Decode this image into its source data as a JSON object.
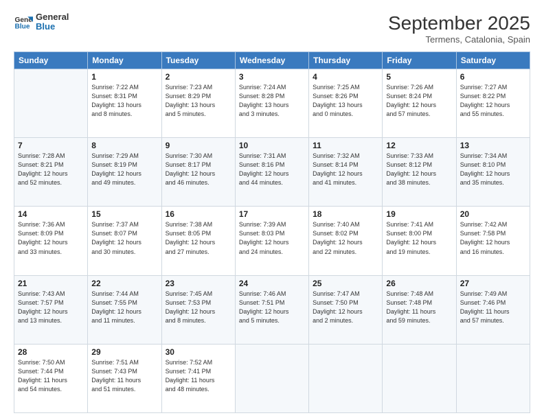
{
  "header": {
    "logo_line1": "General",
    "logo_line2": "Blue",
    "month": "September 2025",
    "location": "Termens, Catalonia, Spain"
  },
  "weekdays": [
    "Sunday",
    "Monday",
    "Tuesday",
    "Wednesday",
    "Thursday",
    "Friday",
    "Saturday"
  ],
  "weeks": [
    [
      {
        "day": "",
        "info": ""
      },
      {
        "day": "1",
        "info": "Sunrise: 7:22 AM\nSunset: 8:31 PM\nDaylight: 13 hours\nand 8 minutes."
      },
      {
        "day": "2",
        "info": "Sunrise: 7:23 AM\nSunset: 8:29 PM\nDaylight: 13 hours\nand 5 minutes."
      },
      {
        "day": "3",
        "info": "Sunrise: 7:24 AM\nSunset: 8:28 PM\nDaylight: 13 hours\nand 3 minutes."
      },
      {
        "day": "4",
        "info": "Sunrise: 7:25 AM\nSunset: 8:26 PM\nDaylight: 13 hours\nand 0 minutes."
      },
      {
        "day": "5",
        "info": "Sunrise: 7:26 AM\nSunset: 8:24 PM\nDaylight: 12 hours\nand 57 minutes."
      },
      {
        "day": "6",
        "info": "Sunrise: 7:27 AM\nSunset: 8:22 PM\nDaylight: 12 hours\nand 55 minutes."
      }
    ],
    [
      {
        "day": "7",
        "info": "Sunrise: 7:28 AM\nSunset: 8:21 PM\nDaylight: 12 hours\nand 52 minutes."
      },
      {
        "day": "8",
        "info": "Sunrise: 7:29 AM\nSunset: 8:19 PM\nDaylight: 12 hours\nand 49 minutes."
      },
      {
        "day": "9",
        "info": "Sunrise: 7:30 AM\nSunset: 8:17 PM\nDaylight: 12 hours\nand 46 minutes."
      },
      {
        "day": "10",
        "info": "Sunrise: 7:31 AM\nSunset: 8:16 PM\nDaylight: 12 hours\nand 44 minutes."
      },
      {
        "day": "11",
        "info": "Sunrise: 7:32 AM\nSunset: 8:14 PM\nDaylight: 12 hours\nand 41 minutes."
      },
      {
        "day": "12",
        "info": "Sunrise: 7:33 AM\nSunset: 8:12 PM\nDaylight: 12 hours\nand 38 minutes."
      },
      {
        "day": "13",
        "info": "Sunrise: 7:34 AM\nSunset: 8:10 PM\nDaylight: 12 hours\nand 35 minutes."
      }
    ],
    [
      {
        "day": "14",
        "info": "Sunrise: 7:36 AM\nSunset: 8:09 PM\nDaylight: 12 hours\nand 33 minutes."
      },
      {
        "day": "15",
        "info": "Sunrise: 7:37 AM\nSunset: 8:07 PM\nDaylight: 12 hours\nand 30 minutes."
      },
      {
        "day": "16",
        "info": "Sunrise: 7:38 AM\nSunset: 8:05 PM\nDaylight: 12 hours\nand 27 minutes."
      },
      {
        "day": "17",
        "info": "Sunrise: 7:39 AM\nSunset: 8:03 PM\nDaylight: 12 hours\nand 24 minutes."
      },
      {
        "day": "18",
        "info": "Sunrise: 7:40 AM\nSunset: 8:02 PM\nDaylight: 12 hours\nand 22 minutes."
      },
      {
        "day": "19",
        "info": "Sunrise: 7:41 AM\nSunset: 8:00 PM\nDaylight: 12 hours\nand 19 minutes."
      },
      {
        "day": "20",
        "info": "Sunrise: 7:42 AM\nSunset: 7:58 PM\nDaylight: 12 hours\nand 16 minutes."
      }
    ],
    [
      {
        "day": "21",
        "info": "Sunrise: 7:43 AM\nSunset: 7:57 PM\nDaylight: 12 hours\nand 13 minutes."
      },
      {
        "day": "22",
        "info": "Sunrise: 7:44 AM\nSunset: 7:55 PM\nDaylight: 12 hours\nand 11 minutes."
      },
      {
        "day": "23",
        "info": "Sunrise: 7:45 AM\nSunset: 7:53 PM\nDaylight: 12 hours\nand 8 minutes."
      },
      {
        "day": "24",
        "info": "Sunrise: 7:46 AM\nSunset: 7:51 PM\nDaylight: 12 hours\nand 5 minutes."
      },
      {
        "day": "25",
        "info": "Sunrise: 7:47 AM\nSunset: 7:50 PM\nDaylight: 12 hours\nand 2 minutes."
      },
      {
        "day": "26",
        "info": "Sunrise: 7:48 AM\nSunset: 7:48 PM\nDaylight: 11 hours\nand 59 minutes."
      },
      {
        "day": "27",
        "info": "Sunrise: 7:49 AM\nSunset: 7:46 PM\nDaylight: 11 hours\nand 57 minutes."
      }
    ],
    [
      {
        "day": "28",
        "info": "Sunrise: 7:50 AM\nSunset: 7:44 PM\nDaylight: 11 hours\nand 54 minutes."
      },
      {
        "day": "29",
        "info": "Sunrise: 7:51 AM\nSunset: 7:43 PM\nDaylight: 11 hours\nand 51 minutes."
      },
      {
        "day": "30",
        "info": "Sunrise: 7:52 AM\nSunset: 7:41 PM\nDaylight: 11 hours\nand 48 minutes."
      },
      {
        "day": "",
        "info": ""
      },
      {
        "day": "",
        "info": ""
      },
      {
        "day": "",
        "info": ""
      },
      {
        "day": "",
        "info": ""
      }
    ]
  ]
}
